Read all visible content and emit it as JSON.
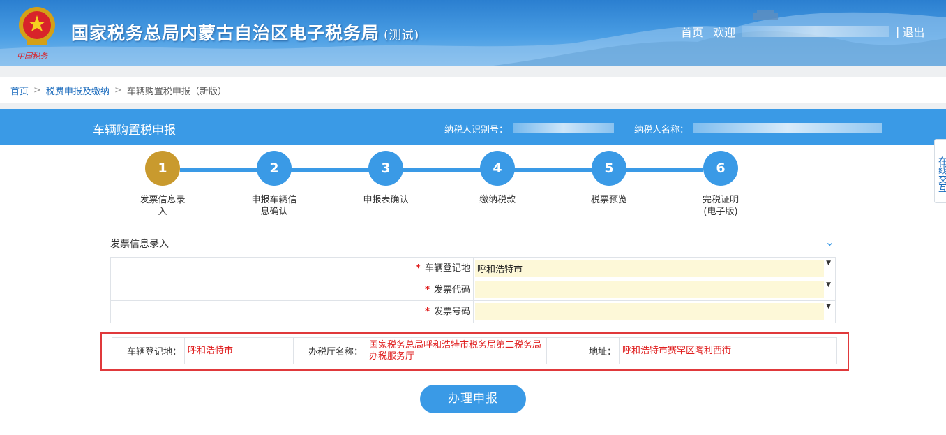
{
  "header": {
    "site_title": "国家税务总局内蒙古自治区电子税务局",
    "site_title_suffix": "(测试)",
    "emblem_text": "中国税务",
    "nav_home": "首页",
    "nav_welcome": "欢迎",
    "nav_sep": "|",
    "nav_logout": "退出"
  },
  "breadcrumb": {
    "items": [
      "首页",
      "税费申报及缴纳",
      "车辆购置税申报（新版）"
    ],
    "arrow": ">"
  },
  "form_bar": {
    "title": "车辆购置税申报",
    "tin_label": "纳税人识别号：",
    "name_label": "纳税人名称："
  },
  "side_tab": {
    "label": "在线交互"
  },
  "steps": [
    {
      "num": "1",
      "label": "发票信息录入"
    },
    {
      "num": "2",
      "label": "申报车辆信息确认"
    },
    {
      "num": "3",
      "label": "申报表确认"
    },
    {
      "num": "4",
      "label": "缴纳税款"
    },
    {
      "num": "5",
      "label": "税票预览"
    },
    {
      "num": "6",
      "label": "完税证明(电子版)"
    }
  ],
  "active_step": 1,
  "section": {
    "heading": "发票信息录入"
  },
  "form": {
    "required_mark": "*",
    "rows": [
      {
        "label": "车辆登记地",
        "value": "呼和浩特市"
      },
      {
        "label": "发票代码",
        "value": ""
      },
      {
        "label": "发票号码",
        "value": ""
      }
    ]
  },
  "info": {
    "reg_label": "车辆登记地：",
    "reg_value": "呼和浩特市",
    "office_label": "办税厅名称：",
    "office_value": "国家税务总局呼和浩特市税务局第二税务局办税服务厅",
    "addr_label": "地址：",
    "addr_value": "呼和浩特市赛罕区陶利西街"
  },
  "submit_label": "办理申报",
  "colors": {
    "primary": "#3a9ae6",
    "active_step": "#c99a2e",
    "required": "#e02020",
    "highlight_border": "#e0393b",
    "input_bg": "#fdf8d8"
  }
}
